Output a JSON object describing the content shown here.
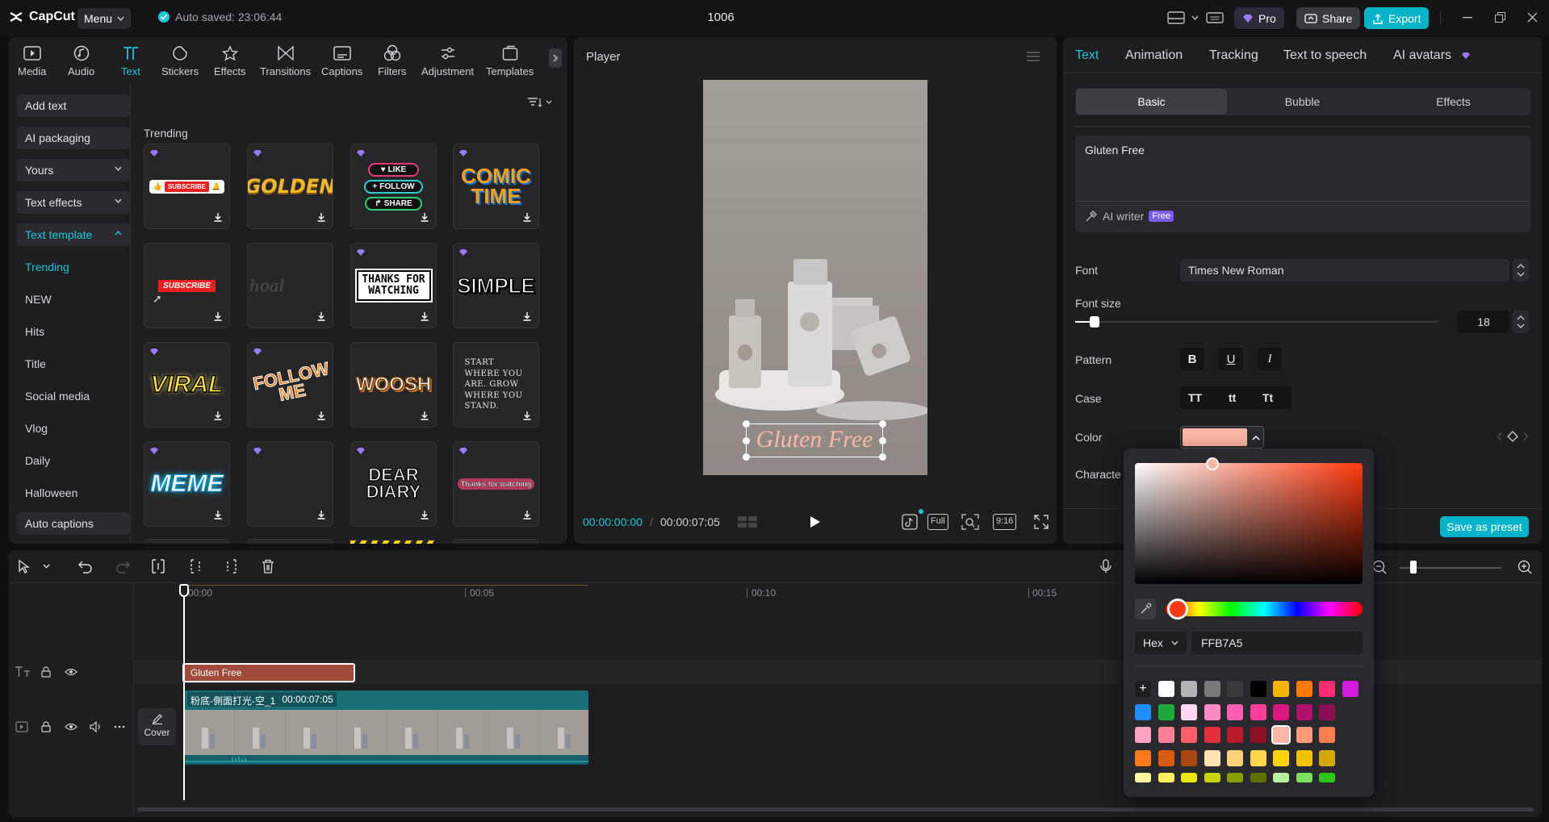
{
  "app": {
    "logo_text": "CapCut",
    "menu_label": "Menu",
    "autosave_text": "Auto saved: 23:06:44",
    "project_title": "1006"
  },
  "topbar": {
    "pro_label": "Pro",
    "share_label": "Share",
    "export_label": "Export"
  },
  "toolbar": {
    "items": [
      {
        "label": "Media",
        "icon": "media-icon"
      },
      {
        "label": "Audio",
        "icon": "audio-icon"
      },
      {
        "label": "Text",
        "icon": "text-icon",
        "active": true
      },
      {
        "label": "Stickers",
        "icon": "stickers-icon"
      },
      {
        "label": "Effects",
        "icon": "effects-icon"
      },
      {
        "label": "Transitions",
        "icon": "transitions-icon"
      },
      {
        "label": "Captions",
        "icon": "captions-icon"
      },
      {
        "label": "Filters",
        "icon": "filters-icon"
      },
      {
        "label": "Adjustment",
        "icon": "adjustment-icon"
      },
      {
        "label": "Templates",
        "icon": "templates-icon"
      }
    ]
  },
  "sidebar": {
    "add_text": "Add text",
    "ai_packaging": "AI packaging",
    "yours": "Yours",
    "text_effects": "Text effects",
    "text_template": "Text template",
    "items": [
      "Trending",
      "NEW",
      "Hits",
      "Title",
      "Social media",
      "Vlog",
      "Daily",
      "Halloween"
    ],
    "auto_captions": "Auto captions"
  },
  "library": {
    "section_title": "Trending",
    "cards": {
      "subscribe": "SUBSCRIBE",
      "golden": "GOLDEN",
      "like": "LIKE",
      "follow": "FOLLOW",
      "share": "SHARE",
      "comic1": "COMIC",
      "comic2": "TIME",
      "subscribe2": "SUBSCRIBE",
      "hoal": "hoal",
      "thanks": "THANKS FOR WATCHING",
      "simple": "SIMPLE",
      "viral": "VIRAL",
      "followme": "FOLLOW ME",
      "woosh": "WOOSH",
      "start": "Start where you are. Grow where you stand.",
      "meme": "MEME",
      "dear": "DEAR DIARY",
      "thanks2": "Thanks for watching"
    }
  },
  "player": {
    "title": "Player",
    "overlay_text": "Gluten Free",
    "current_time": "00:00:00:00",
    "duration": "00:00:07:05",
    "full_label": "Full",
    "ratio_label": "9:16"
  },
  "props": {
    "tabs": [
      "Text",
      "Animation",
      "Tracking",
      "Text to speech",
      "AI avatars"
    ],
    "segments": [
      "Basic",
      "Bubble",
      "Effects"
    ],
    "text_value": "Gluten Free",
    "ai_writer": "AI writer",
    "ai_writer_badge": "Free",
    "font_label": "Font",
    "font_value": "Times New Roman",
    "font_size_label": "Font size",
    "font_size_value": "18",
    "pattern_label": "Pattern",
    "pattern_buttons": [
      "B",
      "U",
      "I"
    ],
    "case_label": "Case",
    "case_buttons": [
      "TT",
      "tt",
      "Tt"
    ],
    "color_label": "Color",
    "character_label": "Characte",
    "save_preset": "Save as preset",
    "color_value": "#FFB7A5"
  },
  "color_picker": {
    "mode": "Hex",
    "hex_value": "FFB7A5",
    "swatches": [
      [
        "#ffffff",
        "#b4b4b4",
        "#7a7a7a",
        "#3a3a3a",
        "#000000",
        "#f5b400",
        "#ff7a00",
        "#ff2d6f",
        "#d41ae0"
      ],
      [
        "#1f8fff",
        "#1aaa3a",
        "#ffd6f0",
        "#ff8ac8",
        "#ff5fb3",
        "#ff3d9a",
        "#d9177c",
        "#b0106a",
        "#8a0d58"
      ],
      [
        "#ffa3c4",
        "#ff7f97",
        "#ff5c6c",
        "#e62e3a",
        "#b81a2a",
        "#8c0f23",
        "#ffb7a5",
        "#ff9a7a",
        "#ff7f50"
      ],
      [
        "#ff7a1a",
        "#d95a10",
        "#a84810",
        "#ffe3b0",
        "#ffd27a",
        "#ffd84d",
        "#ffd400",
        "#f2c200",
        "#d4a600"
      ],
      [
        "#fff7a0",
        "#fff15c",
        "#e8e800",
        "#c8d600",
        "#8a9e00",
        "#5c7000",
        "#b8f0a0",
        "#7be05c",
        "#2ec41a"
      ]
    ]
  },
  "timeline": {
    "ruler": [
      "00:00",
      "00:05",
      "00:10",
      "00:15"
    ],
    "text_clip": "Gluten Free",
    "video_clip_name": "粉底-側面打光-空_1",
    "video_clip_duration": "00:00:07:05",
    "cover_label": "Cover"
  }
}
